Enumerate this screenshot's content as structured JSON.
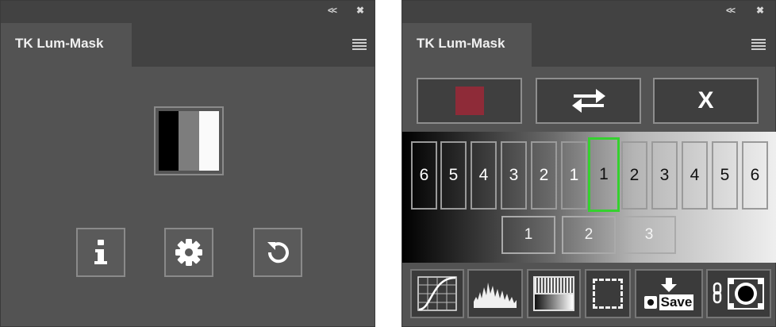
{
  "left_panel": {
    "tab_title": "TK Lum-Mask",
    "collapse_glyph": "<<",
    "close_glyph": "✖",
    "logo_icon": "lum-mask-logo-icon",
    "buttons": [
      {
        "name": "info-button",
        "icon": "info-icon"
      },
      {
        "name": "settings-button",
        "icon": "gear-icon"
      },
      {
        "name": "reset-button",
        "icon": "undo-icon"
      }
    ]
  },
  "right_panel": {
    "tab_title": "TK Lum-Mask",
    "collapse_glyph": "<<",
    "close_glyph": "✖",
    "top_buttons": {
      "color_swatch": "#8e2b38",
      "swap_icon": "swap-arrows-icon",
      "close_label": "X"
    },
    "lights": [
      "6",
      "5",
      "4",
      "3",
      "2",
      "1"
    ],
    "darks": [
      "1",
      "2",
      "3",
      "4",
      "5",
      "6"
    ],
    "midtones": [
      "1",
      "2",
      "3"
    ],
    "selected": "darks.0",
    "tools": [
      {
        "name": "curves-button",
        "icon": "curves-icon"
      },
      {
        "name": "histogram-button",
        "icon": "histogram-icon"
      },
      {
        "name": "gradient-button",
        "icon": "gradient-icon"
      },
      {
        "name": "selection-button",
        "icon": "marquee-selection-icon"
      },
      {
        "name": "save-button",
        "icon": "save-arrow-icon",
        "label": "Save"
      },
      {
        "name": "link-mask-button",
        "icon": "link-mask-icon"
      }
    ]
  },
  "colors": {
    "panel_bg": "#535353",
    "tab_strip": "#424242",
    "selected_border": "#35d12f"
  }
}
